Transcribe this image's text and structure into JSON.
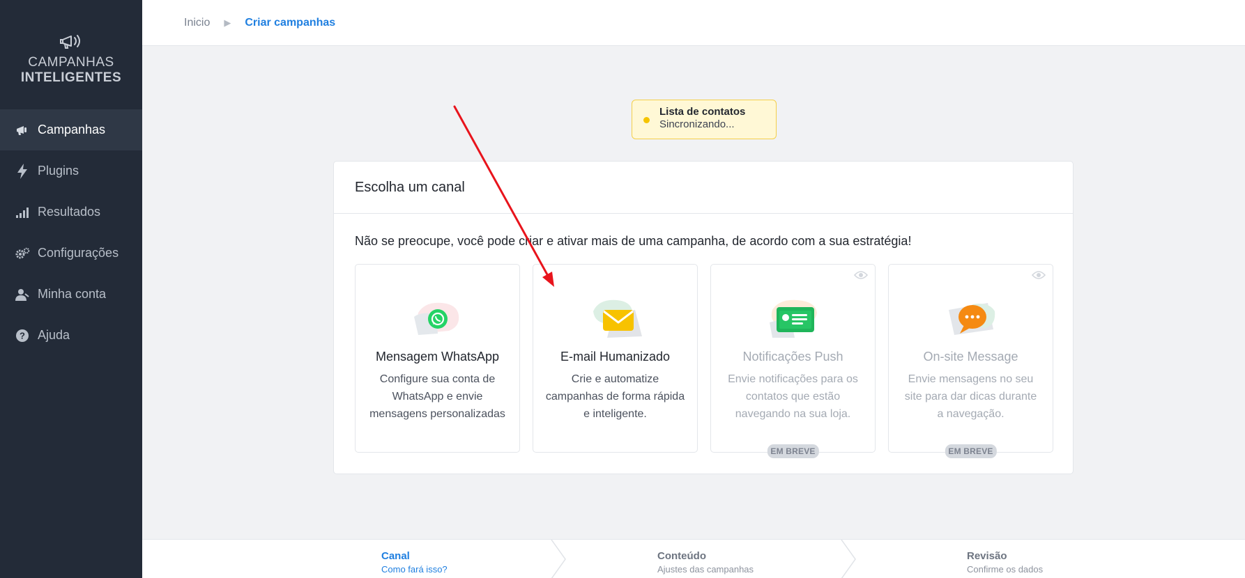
{
  "sidebar": {
    "logo_line1": "CAMPANHAS",
    "logo_line2": "INTELIGENTES",
    "items": [
      {
        "label": "Campanhas",
        "icon": "megaphone-icon",
        "active": true
      },
      {
        "label": "Plugins",
        "icon": "lightning-icon",
        "active": false
      },
      {
        "label": "Resultados",
        "icon": "bar-chart-icon",
        "active": false
      },
      {
        "label": "Configurações",
        "icon": "gears-icon",
        "active": false
      },
      {
        "label": "Minha conta",
        "icon": "user-icon",
        "active": false
      },
      {
        "label": "Ajuda",
        "icon": "help-icon",
        "active": false
      }
    ]
  },
  "breadcrumb": {
    "items": [
      "Inicio",
      "Criar campanhas"
    ]
  },
  "sync": {
    "title": "Lista de contatos",
    "status": "Sincronizando..."
  },
  "card": {
    "title": "Escolha um canal",
    "description": "Não se preocupe, você pode criar e ativar mais de uma campanha, de acordo com a sua estratégia!",
    "channels": [
      {
        "title": "Mensagem WhatsApp",
        "desc": "Configure sua conta de WhatsApp e envie mensagens personalizadas",
        "icon": "whatsapp-icon",
        "disabled": false,
        "badge": ""
      },
      {
        "title": "E-mail Humanizado",
        "desc": "Crie e automatize campanhas de forma rápida e inteligente.",
        "icon": "envelope-icon",
        "disabled": false,
        "badge": ""
      },
      {
        "title": "Notificações Push",
        "desc": "Envie notificações para os contatos que estão navegando na sua loja.",
        "icon": "notification-card-icon",
        "disabled": true,
        "badge": "EM BREVE"
      },
      {
        "title": "On-site Message",
        "desc": "Envie mensagens no seu site para dar dicas durante a navegação.",
        "icon": "chat-bubble-icon",
        "disabled": true,
        "badge": "EM BREVE"
      }
    ]
  },
  "steps": [
    {
      "title": "Canal",
      "sub": "Como fará isso?",
      "active": true
    },
    {
      "title": "Conteúdo",
      "sub": "Ajustes das campanhas",
      "active": false
    },
    {
      "title": "Revisão",
      "sub": "Confirme os dados",
      "active": false
    }
  ],
  "colors": {
    "sidebar_bg": "#232b38",
    "accent": "#1f7fe0",
    "whatsapp": "#25d366",
    "email": "#f7c200",
    "push": "#1fb55a",
    "onsite": "#f58a12",
    "arrow": "#e8141c"
  }
}
